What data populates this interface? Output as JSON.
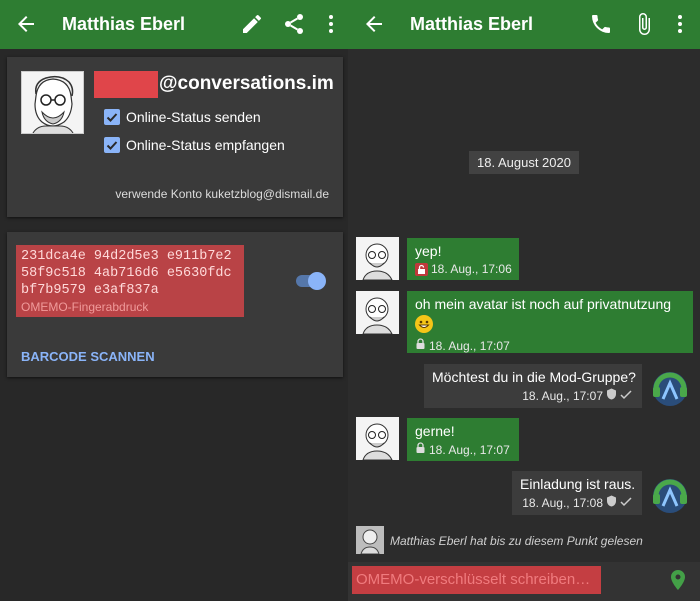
{
  "left": {
    "appbar": {
      "title": "Matthias Eberl",
      "icons": [
        "arrow-back-icon",
        "pencil-icon",
        "share-icon",
        "more-vert-icon"
      ]
    },
    "account": {
      "jid_suffix": "@conversations.im",
      "checkbox1": "Online-Status senden",
      "checkbox2": "Online-Status empfangen",
      "konto": "verwende Konto kuketzblog@dismail.de"
    },
    "omemo": {
      "fingerprint": "231dca4e 94d2d5e3 e911b7e2\n58f9c518 4ab716d6 e5630fdc\nbf7b9579 e3af837a",
      "label": "OMEMO-Fingerabdruck",
      "scan": "BARCODE SCANNEN",
      "trusted": true
    }
  },
  "right": {
    "appbar": {
      "title": "Matthias Eberl",
      "icons": [
        "arrow-back-icon",
        "phone-icon",
        "attach-icon",
        "more-vert-icon"
      ]
    },
    "date": "18. August 2020",
    "messages": [
      {
        "dir": "in",
        "text": "yep!",
        "time": "18. Aug., 17:06"
      },
      {
        "dir": "in",
        "text": "oh mein avatar ist noch auf privatnutzung",
        "time": "18. Aug., 17:07"
      },
      {
        "dir": "out",
        "text": "Möchtest du in die Mod-Gruppe?",
        "time": "18. Aug., 17:07"
      },
      {
        "dir": "in",
        "text": "gerne!",
        "time": "18. Aug., 17:07"
      },
      {
        "dir": "out",
        "text": "Einladung ist raus.",
        "time": "18. Aug., 17:08"
      }
    ],
    "read_marker": "Matthias Eberl hat bis zu diesem Punkt gelesen",
    "input_placeholder": "OMEMO-verschlüsselt schreiben…"
  },
  "colors": {
    "appbar": "#2e7d32",
    "incoming": "#2e7d32",
    "outgoing": "#3c3c3c",
    "accent": "#8ab4f8",
    "redaction": "#e0454a"
  }
}
